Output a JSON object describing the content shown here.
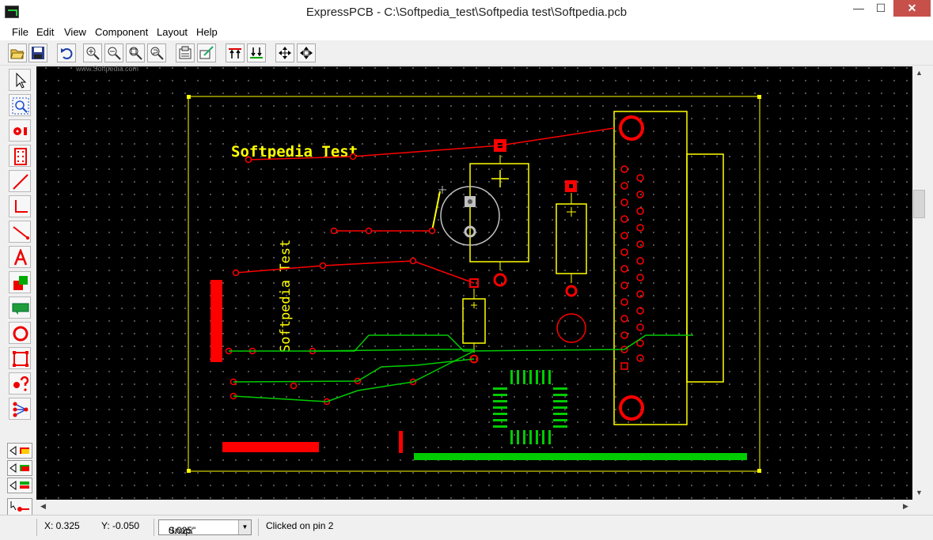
{
  "window": {
    "title": "ExpressPCB - C:\\Softpedia_test\\Softpedia test\\Softpedia.pcb",
    "minimize_label": "—",
    "maximize_label": "☐",
    "close_label": "✕"
  },
  "menu": [
    "File",
    "Edit",
    "View",
    "Component",
    "Layout",
    "Help"
  ],
  "toolbar": {
    "buttons": [
      "open-icon",
      "save-icon",
      "undo-icon",
      "zoom-in-icon",
      "zoom-out-icon",
      "zoom-fit-icon",
      "zoom-previous-icon",
      "properties-icon",
      "edit-component-icon",
      "layer-top-icon",
      "layer-bottom-icon",
      "move-icon",
      "move-all-icon"
    ]
  },
  "left_tools": [
    "select-icon",
    "zoom-select-icon",
    "place-pad-icon",
    "place-component-icon",
    "trace-icon",
    "corner-trace-icon",
    "diagonal-trace-icon",
    "text-icon",
    "filled-shape-icon",
    "jumper-icon",
    "circle-icon",
    "rectangle-icon",
    "query-icon",
    "netlist-icon",
    "layer-top-visible-icon",
    "layer-bottom-visible-icon",
    "layer-both-visible-icon",
    "insert-vertex-icon"
  ],
  "watermark": "www.Softpedia.com",
  "board": {
    "title_text": "Softpedia Test",
    "vertical_text": "Softpedia Test",
    "colors": {
      "background": "#000000",
      "silkscreen": "#ffff00",
      "top_copper": "#ff0000",
      "bottom_copper": "#00cc00",
      "outline": "#ffff00",
      "drill": "#c0c0c0"
    }
  },
  "status": {
    "x_label": "X: 0.325",
    "y_label": "Y: -0.050",
    "snap_label": "Snap:",
    "snap_value": "0.025\"",
    "message": "Clicked on pin 2"
  }
}
